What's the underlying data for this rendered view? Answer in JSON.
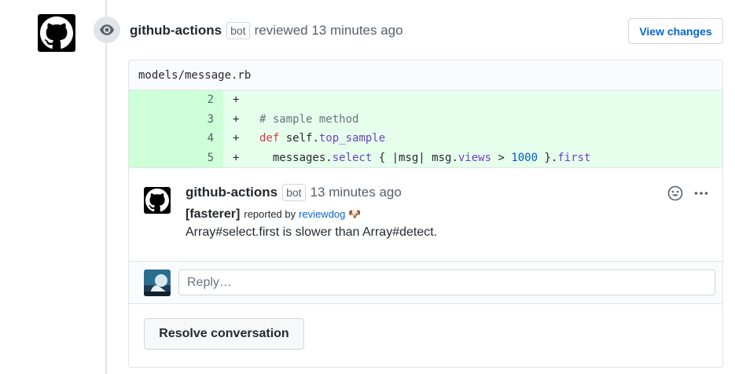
{
  "review": {
    "author": "github-actions",
    "badge": "bot",
    "action_text": "reviewed 13 minutes ago",
    "view_changes_label": "View changes"
  },
  "file": {
    "path": "models/message.rb"
  },
  "diff_lines": [
    {
      "num": "2",
      "sign": "+"
    },
    {
      "num": "3",
      "sign": "+"
    },
    {
      "num": "4",
      "sign": "+"
    },
    {
      "num": "5",
      "sign": "+"
    }
  ],
  "code": {
    "line3_comment": "# sample method",
    "line4_kw": "def",
    "line4_self": " self.",
    "line4_fn": "top_sample",
    "line5_indent": "  messages.",
    "line5_select": "select",
    "line5_mid": " { |msg| msg.",
    "line5_views": "views",
    "line5_gt": " > ",
    "line5_num": "1000",
    "line5_close": " }.",
    "line5_first": "first"
  },
  "comment": {
    "author": "github-actions",
    "badge": "bot",
    "time": "13 minutes ago",
    "tag": "[fasterer]",
    "reported_by": "reported by",
    "reporter_link": "reviewdog",
    "reporter_emoji": "🐶",
    "message": "Array#select.first is slower than Array#detect."
  },
  "reply": {
    "placeholder": "Reply…"
  },
  "resolve_label": "Resolve conversation",
  "colors": {
    "link": "#0366d6",
    "addition_bg": "#e6ffed",
    "addition_num_bg": "#cdffd8"
  }
}
